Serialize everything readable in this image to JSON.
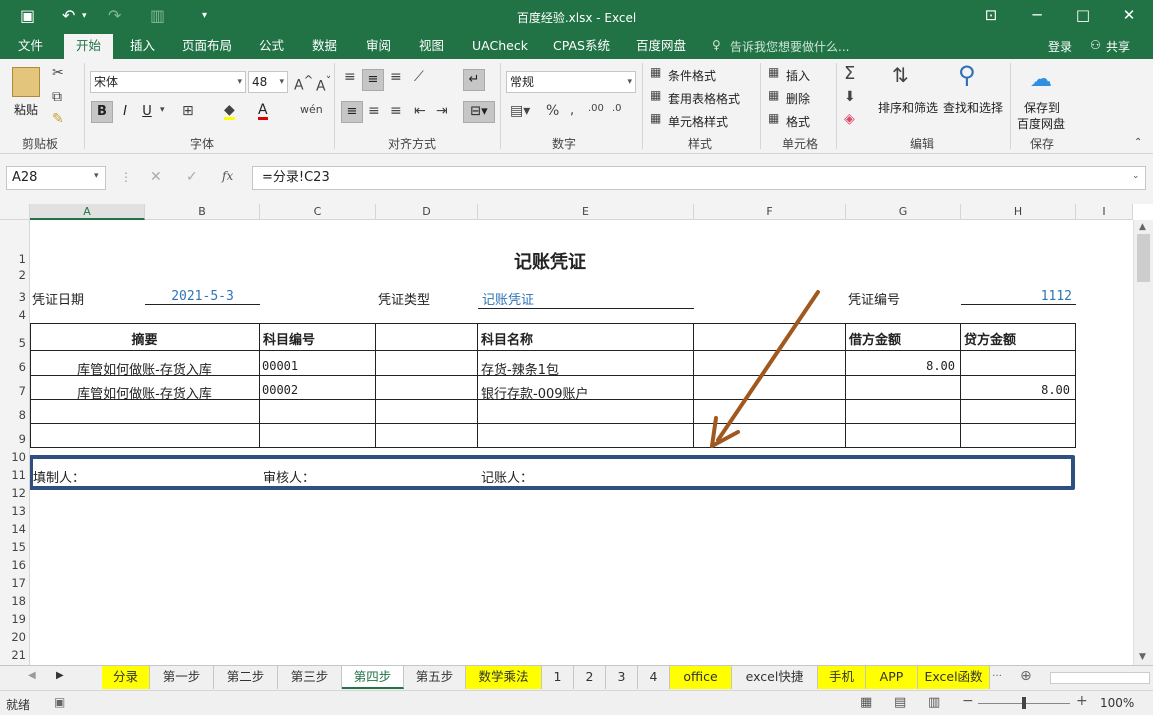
{
  "titlebar": {
    "title": "百度经验.xlsx - Excel"
  },
  "ribbon_tabs": [
    "文件",
    "开始",
    "插入",
    "页面布局",
    "公式",
    "数据",
    "审阅",
    "视图",
    "UACheck",
    "CPAS系统",
    "百度网盘"
  ],
  "tell_me": "告诉我您想要做什么...",
  "account": {
    "login": "登录",
    "share": "共享"
  },
  "ribbon": {
    "clipboard": {
      "paste": "粘贴",
      "label": "剪贴板"
    },
    "font": {
      "name": "宋体",
      "size": "48",
      "label": "字体",
      "bold": "B",
      "italic": "I",
      "underline": "U"
    },
    "align": {
      "label": "对齐方式"
    },
    "number": {
      "format": "常规",
      "label": "数字"
    },
    "styles": {
      "cond": "条件格式",
      "table": "套用表格格式",
      "cell": "单元格样式",
      "label": "样式"
    },
    "cells": {
      "insert": "插入",
      "delete": "删除",
      "format": "格式",
      "label": "单元格"
    },
    "editing": {
      "sort": "排序和筛选",
      "find": "查找和选择",
      "label": "编辑"
    },
    "save": {
      "btn1": "保存到",
      "btn2": "百度网盘",
      "label": "保存"
    }
  },
  "formula_bar": {
    "name_box": "A28",
    "formula": "=分录!C23"
  },
  "columns": [
    "A",
    "B",
    "C",
    "D",
    "E",
    "F",
    "G",
    "H",
    "I"
  ],
  "rows": [
    "1",
    "2",
    "3",
    "4",
    "5",
    "6",
    "7",
    "8",
    "9",
    "10",
    "11",
    "12",
    "13",
    "14",
    "15",
    "16",
    "17",
    "18",
    "19",
    "20",
    "21"
  ],
  "voucher": {
    "title": "记账凭证",
    "date_label": "凭证日期",
    "date_value": "2021-5-3",
    "type_label": "凭证类型",
    "type_value": "记账凭证",
    "no_label": "凭证编号",
    "no_value": "1112",
    "headers": {
      "summary": "摘要",
      "code": "科目编号",
      "name": "科目名称",
      "debit": "借方金额",
      "credit": "贷方金额"
    },
    "lines": [
      {
        "summary": "库管如何做账-存货入库",
        "code": "00001",
        "name": "存货-辣条1包",
        "debit": "8.00",
        "credit": ""
      },
      {
        "summary": "库管如何做账-存货入库",
        "code": "00002",
        "name": "银行存款-009账户",
        "debit": "",
        "credit": "8.00"
      }
    ],
    "maker": "填制人：",
    "checker": "审核人：",
    "bookkeeper": "记账人："
  },
  "sheet_tabs": [
    {
      "label": "分录",
      "highlight": true
    },
    {
      "label": "第一步",
      "highlight": false
    },
    {
      "label": "第二步",
      "highlight": false
    },
    {
      "label": "第三步",
      "highlight": false
    },
    {
      "label": "第四步",
      "active": true
    },
    {
      "label": "第五步",
      "highlight": false
    },
    {
      "label": "数学乘法",
      "highlight": true
    },
    {
      "label": "1",
      "highlight": false
    },
    {
      "label": "2",
      "highlight": false
    },
    {
      "label": "3",
      "highlight": false
    },
    {
      "label": "4",
      "highlight": false
    },
    {
      "label": "office",
      "highlight": true
    },
    {
      "label": "excel快捷",
      "highlight": false
    },
    {
      "label": "手机",
      "highlight": true
    },
    {
      "label": "APP",
      "highlight": true
    },
    {
      "label": "Excel函数",
      "highlight": true
    }
  ],
  "status": {
    "ready": "就绪",
    "zoom": "100%"
  },
  "colors": {
    "excel_green": "#217346",
    "arrow": "#a0581e",
    "box": "#2f4f7f",
    "highlight": "#ffff00"
  }
}
